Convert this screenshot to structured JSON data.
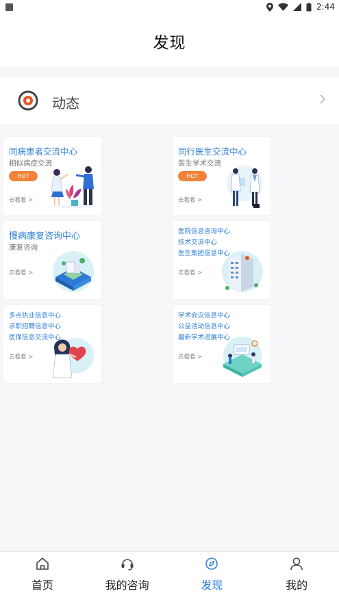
{
  "status_bar": {
    "time": "2:44"
  },
  "header": {
    "title": "发现"
  },
  "dynamic": {
    "label": "动态"
  },
  "cards": [
    {
      "title": "同病患者交流中心",
      "subtitle": "相似病症交流",
      "badge": "HOT",
      "link": "去看看 >"
    },
    {
      "title": "同行医生交流中心",
      "subtitle": "医生学术交流",
      "badge": "HOT",
      "link": "去看看 >"
    },
    {
      "title": "慢病康复咨询中心",
      "subtitle": "康复咨询",
      "link": "去看看 >"
    },
    {
      "lines": [
        "医院信息咨询中心",
        "技术交流中心",
        "医生集团信息中心"
      ],
      "link": "去看看 >"
    },
    {
      "lines": [
        "多点执业信息中心",
        "求职招聘信息中心",
        "医保信息交流中心"
      ],
      "link": "去看看 >"
    },
    {
      "lines": [
        "学术会议信息中心",
        "公益活动信息中心",
        "最新学术进展中心"
      ],
      "link": "去看看 >"
    }
  ],
  "tabbar": {
    "items": [
      {
        "label": "首页",
        "icon": "home-icon"
      },
      {
        "label": "我的咨询",
        "icon": "headset-icon"
      },
      {
        "label": "发现",
        "icon": "compass-icon",
        "active": true
      },
      {
        "label": "我的",
        "icon": "user-icon"
      }
    ]
  },
  "colors": {
    "accent": "#2f7fd8",
    "hot": "#f0833a",
    "dynamic_icon": "#e8571e"
  }
}
